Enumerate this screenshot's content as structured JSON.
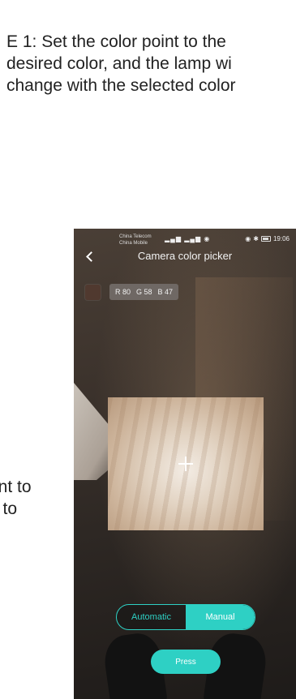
{
  "caption": {
    "line1": "E 1: Set the color point to the",
    "line2": "desired color, and the lamp wi",
    "line3": "change with the selected color"
  },
  "side_text": {
    "line1": "ant to",
    "line2": "n to"
  },
  "status_bar": {
    "carrier1": "China Telecom",
    "carrier2": "China Mobile",
    "signal": "▂▄▆ ▂▄▆ ◉",
    "time": "19:06"
  },
  "header": {
    "title": "Camera color picker"
  },
  "readout": {
    "r": "R 80",
    "g": "G 58",
    "b": "B 47",
    "swatch_color": "#50392f"
  },
  "mode": {
    "automatic": "Automatic",
    "manual": "Manual",
    "selected": "Manual"
  },
  "press_button": "Press",
  "colors": {
    "accent": "#2ed0c4"
  }
}
